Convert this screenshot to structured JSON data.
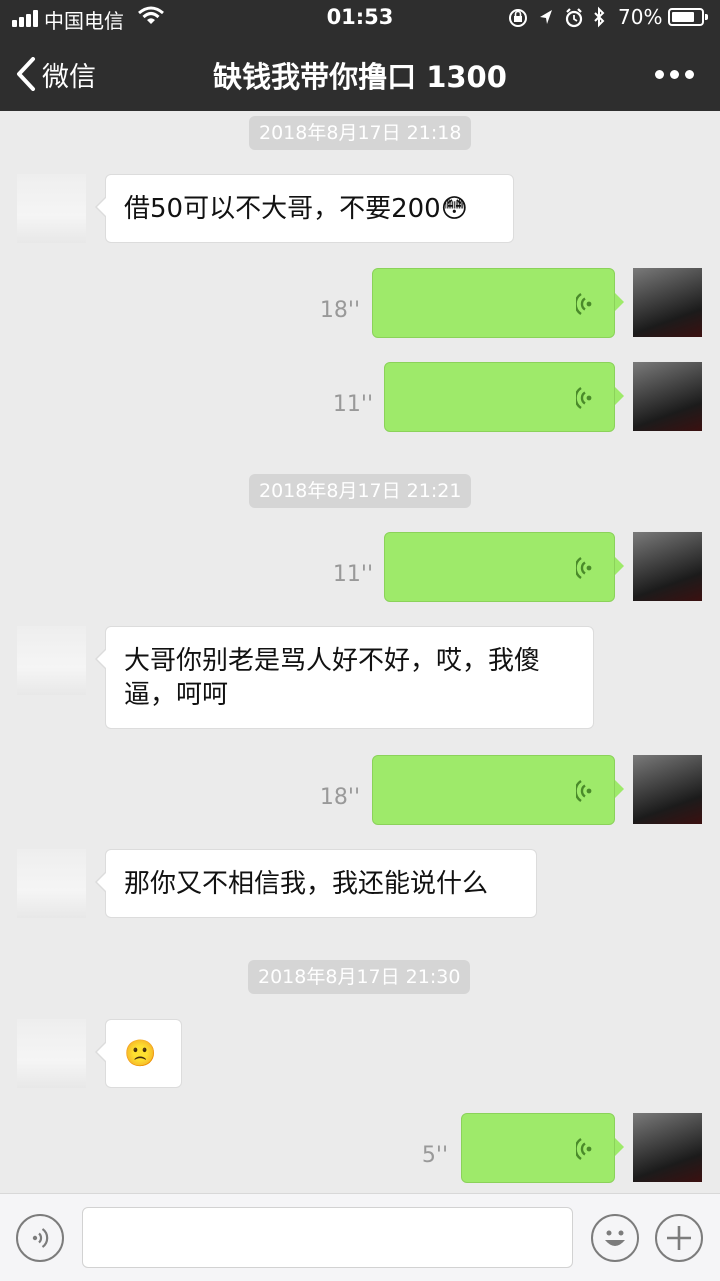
{
  "status_bar": {
    "carrier": "中国电信",
    "time": "01:53",
    "battery_percent": "70%",
    "battery_level": 0.7,
    "icons": [
      "signal-icon",
      "wifi-icon",
      "orientation-lock-icon",
      "location-icon",
      "alarm-icon",
      "bluetooth-icon",
      "battery-icon"
    ]
  },
  "nav": {
    "back_label": "微信",
    "title": "缺钱我带你撸口 1300",
    "more_icon": "more-dots-icon"
  },
  "colors": {
    "nav_bg": "#2e2e2e",
    "chat_bg": "#ebebeb",
    "outgoing_bubble": "#9eea6a",
    "incoming_bubble": "#ffffff"
  },
  "messages": [
    {
      "type": "timestamp",
      "text": "2018年8月17日 21:18"
    },
    {
      "type": "text",
      "from": "them",
      "text": "借50可以不大哥，不要200",
      "emoji": "😳"
    },
    {
      "type": "voice",
      "from": "me",
      "duration": "18''"
    },
    {
      "type": "voice",
      "from": "me",
      "duration": "11''"
    },
    {
      "type": "timestamp",
      "text": "2018年8月17日 21:21"
    },
    {
      "type": "voice",
      "from": "me",
      "duration": "11''"
    },
    {
      "type": "text",
      "from": "them",
      "text": "大哥你别老是骂人好不好，哎，我傻逼，呵呵"
    },
    {
      "type": "voice",
      "from": "me",
      "duration": "18''"
    },
    {
      "type": "text",
      "from": "them",
      "text": "那你又不相信我，我还能说什么"
    },
    {
      "type": "timestamp",
      "text": "2018年8月17日 21:30"
    },
    {
      "type": "emoji",
      "from": "them",
      "emoji": "🙁"
    },
    {
      "type": "voice",
      "from": "me",
      "duration": "5''"
    }
  ],
  "input_bar": {
    "voice_button_icon": "voice-input-icon",
    "emoji_button_icon": "emoji-icon",
    "plus_button_icon": "plus-icon",
    "text_value": ""
  }
}
